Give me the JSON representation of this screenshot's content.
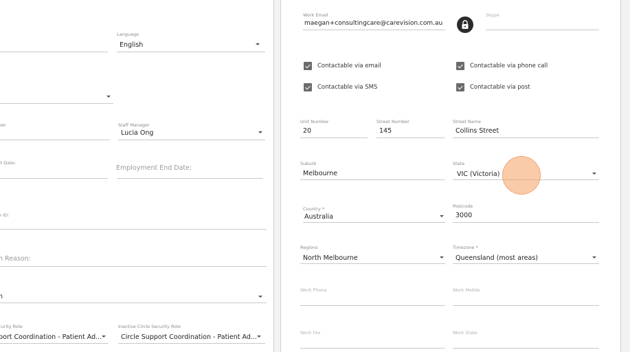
{
  "left": {
    "language_label": "Language",
    "language_value": "English",
    "staff_manager_label": "Staff Manager",
    "staff_manager_value": "Lucia Ong",
    "number_label_partial": "ber",
    "start_date_label_partial": "rt Date:",
    "employment_end_date_placeholder": "Employment End Date:",
    "id_label_partial": "e ID:",
    "reason_label_partial": "n Reason:",
    "dropdown_value_partial": "h",
    "security_role_label_partial": "curity Role",
    "security_role_value_partial": "port Coordination - Patient Ad...",
    "inactive_security_role_label": "Inactive Circle Security Role",
    "inactive_security_role_value": "Circle Support Coordination - Patient Ad..."
  },
  "right": {
    "work_email_label": "Work Email",
    "work_email_value": "maegan+consultingcare@carevision.com.au",
    "skype_label": "Skype",
    "checkboxes": {
      "email": "Contactable via email",
      "phone": "Contactable via phone call",
      "sms": "Contactable via SMS",
      "post": "Contactable via post"
    },
    "unit_number_label": "Unit Number",
    "unit_number_value": "20",
    "street_number_label": "Street Number",
    "street_number_value": "145",
    "street_name_label": "Street Name",
    "street_name_value": "Collins Street",
    "suburb_label": "Suburb",
    "suburb_value": "Melbourne",
    "state_label": "State",
    "state_value": "VIC (Victoria)",
    "country_label": "Country *",
    "country_value": "Australia",
    "postcode_label": "Postcode",
    "postcode_value": "3000",
    "regions_label": "Regions",
    "regions_value": "North Melbourne",
    "timezone_label": "Timezone *",
    "timezone_value": "Queensland (most areas)",
    "work_phone_label": "Work Phone",
    "work_mobile_label": "Work Mobile",
    "work_fax_label": "Work Fax",
    "work_state_label": "Work State"
  },
  "icons": {
    "lock": "lock-icon",
    "checkbox_checked": "check-icon",
    "dropdown": "chevron-down-icon"
  },
  "colors": {
    "checkbox": "#6b6b6b",
    "cursor_highlight": "#f5a060"
  }
}
